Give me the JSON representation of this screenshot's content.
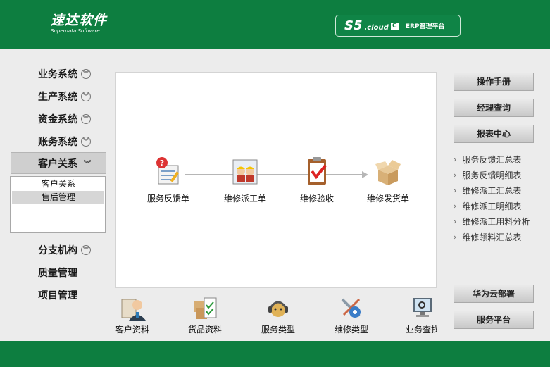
{
  "header": {
    "logo_cn": "速达软件",
    "logo_en": "Superdata Software",
    "brand_s5": "S5",
    "brand_cloud": ".cloud",
    "brand_c": "C",
    "brand_erp": "ERP管理平台"
  },
  "sidenav": {
    "items": [
      {
        "label": "业务系统",
        "icon": "double-chevron-down-icon"
      },
      {
        "label": "生产系统",
        "icon": "double-chevron-down-icon"
      },
      {
        "label": "资金系统",
        "icon": "double-chevron-down-icon"
      },
      {
        "label": "账务系统",
        "icon": "double-chevron-down-icon"
      }
    ],
    "active": {
      "label": "客户关系",
      "icon": "double-chevron-down-icon"
    },
    "sub_items": [
      "客户关系",
      "售后管理"
    ],
    "items_after": [
      {
        "label": "分支机构",
        "icon": "double-chevron-down-icon"
      },
      {
        "label": "质量管理"
      },
      {
        "label": "项目管理"
      }
    ]
  },
  "flow": {
    "steps": [
      {
        "label": "服务反馈单",
        "icon": "feedback-form-icon"
      },
      {
        "label": "维修派工单",
        "icon": "workers-dispatch-icon"
      },
      {
        "label": "维修验收",
        "icon": "clipboard-check-icon"
      },
      {
        "label": "维修发货单",
        "icon": "open-box-icon"
      }
    ]
  },
  "tray": {
    "items": [
      {
        "label": "客户资料",
        "icon": "customer-profile-icon"
      },
      {
        "label": "货品资料",
        "icon": "goods-checklist-icon"
      },
      {
        "label": "服务类型",
        "icon": "headset-support-icon"
      },
      {
        "label": "维修类型",
        "icon": "repair-tools-icon"
      },
      {
        "label": "业务查找",
        "icon": "search-monitor-icon"
      }
    ]
  },
  "right": {
    "btn_manual": "操作手册",
    "btn_manager": "经理查询",
    "btn_reports": "报表中心",
    "reports": [
      "服务反馈汇总表",
      "服务反馈明细表",
      "维修派工汇总表",
      "维修派工明细表",
      "维修派工用料分析",
      "维修领料汇总表"
    ],
    "btn_huawei": "华为云部署",
    "btn_service": "服务平台"
  },
  "colors": {
    "brand_green": "#0d7e40",
    "panel_bg": "#ececec",
    "button_gray": "#d6d6d6"
  }
}
